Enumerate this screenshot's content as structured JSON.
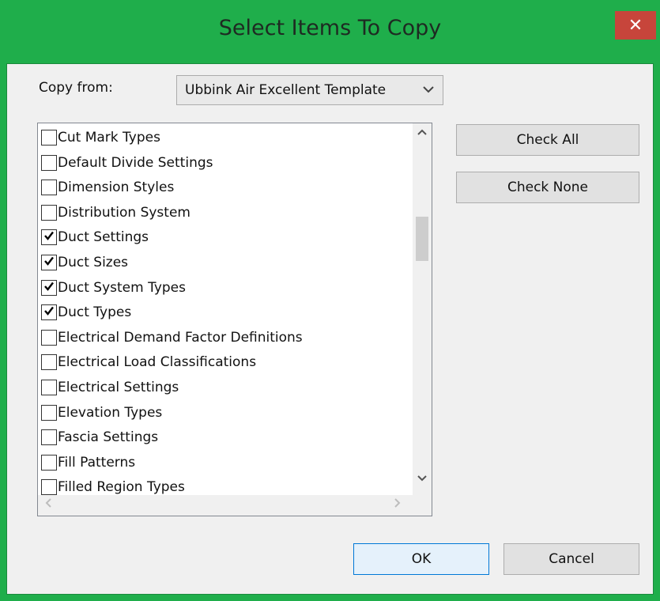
{
  "window": {
    "title": "Select Items To Copy",
    "close_glyph": "✕",
    "accent": "#1fae4b"
  },
  "copy_from": {
    "label": "Copy from:",
    "selected": "Ubbink Air Excellent Template",
    "arrow_icon": "chevron-down-icon"
  },
  "items": [
    {
      "label": "Cut Mark Types",
      "checked": false
    },
    {
      "label": "Default Divide Settings",
      "checked": false
    },
    {
      "label": "Dimension Styles",
      "checked": false
    },
    {
      "label": "Distribution System",
      "checked": false
    },
    {
      "label": "Duct Settings",
      "checked": true
    },
    {
      "label": "Duct Sizes",
      "checked": true
    },
    {
      "label": "Duct System Types",
      "checked": true
    },
    {
      "label": "Duct Types",
      "checked": true
    },
    {
      "label": "Electrical Demand Factor Definitions",
      "checked": false
    },
    {
      "label": "Electrical Load Classifications",
      "checked": false
    },
    {
      "label": "Electrical Settings",
      "checked": false
    },
    {
      "label": "Elevation Types",
      "checked": false
    },
    {
      "label": "Fascia Settings",
      "checked": false
    },
    {
      "label": "Fill Patterns",
      "checked": false
    },
    {
      "label": "Filled Region Types",
      "checked": false
    }
  ],
  "buttons": {
    "check_all": "Check All",
    "check_none": "Check None",
    "ok": "OK",
    "cancel": "Cancel"
  }
}
